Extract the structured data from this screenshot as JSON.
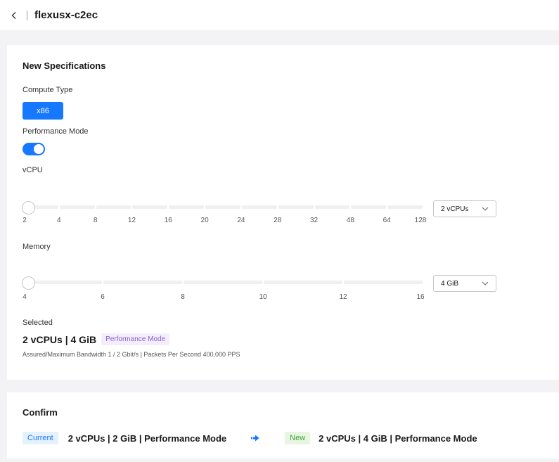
{
  "header": {
    "title": "flexusx-c2ec"
  },
  "spec": {
    "title": "New Specifications",
    "compute_type": {
      "label": "Compute Type",
      "options": [
        "x86"
      ],
      "selected": "x86"
    },
    "performance_mode": {
      "label": "Performance Mode",
      "enabled": true
    },
    "vcpu": {
      "label": "vCPU",
      "ticks": [
        "2",
        "4",
        "8",
        "12",
        "16",
        "20",
        "24",
        "28",
        "32",
        "48",
        "64",
        "128"
      ],
      "value_index": 0,
      "select_value": "2 vCPUs"
    },
    "memory": {
      "label": "Memory",
      "ticks": [
        "4",
        "6",
        "8",
        "10",
        "12",
        "16"
      ],
      "value_index": 0,
      "select_value": "4 GiB"
    },
    "selected": {
      "label": "Selected",
      "value": "2 vCPUs | 4 GiB",
      "tag": "Performance Mode",
      "bandwidth_text": "Assured/Maximum Bandwidth  1 / 2 Gbit/s  |  Packets Per Second  400,000 PPS"
    }
  },
  "confirm": {
    "title": "Confirm",
    "current_tag": "Current",
    "current_value": "2 vCPUs | 2 GiB | Performance Mode",
    "new_tag": "New",
    "new_value": "2 vCPUs | 4 GiB | Performance Mode"
  },
  "colors": {
    "accent": "#1677ff",
    "purple_tag": "#8a5cd6",
    "green_tag": "#3ea238"
  },
  "icons": {
    "back": "chevron-left-icon",
    "dropdown": "chevron-down-icon",
    "arrow": "arrow-right-icon"
  }
}
